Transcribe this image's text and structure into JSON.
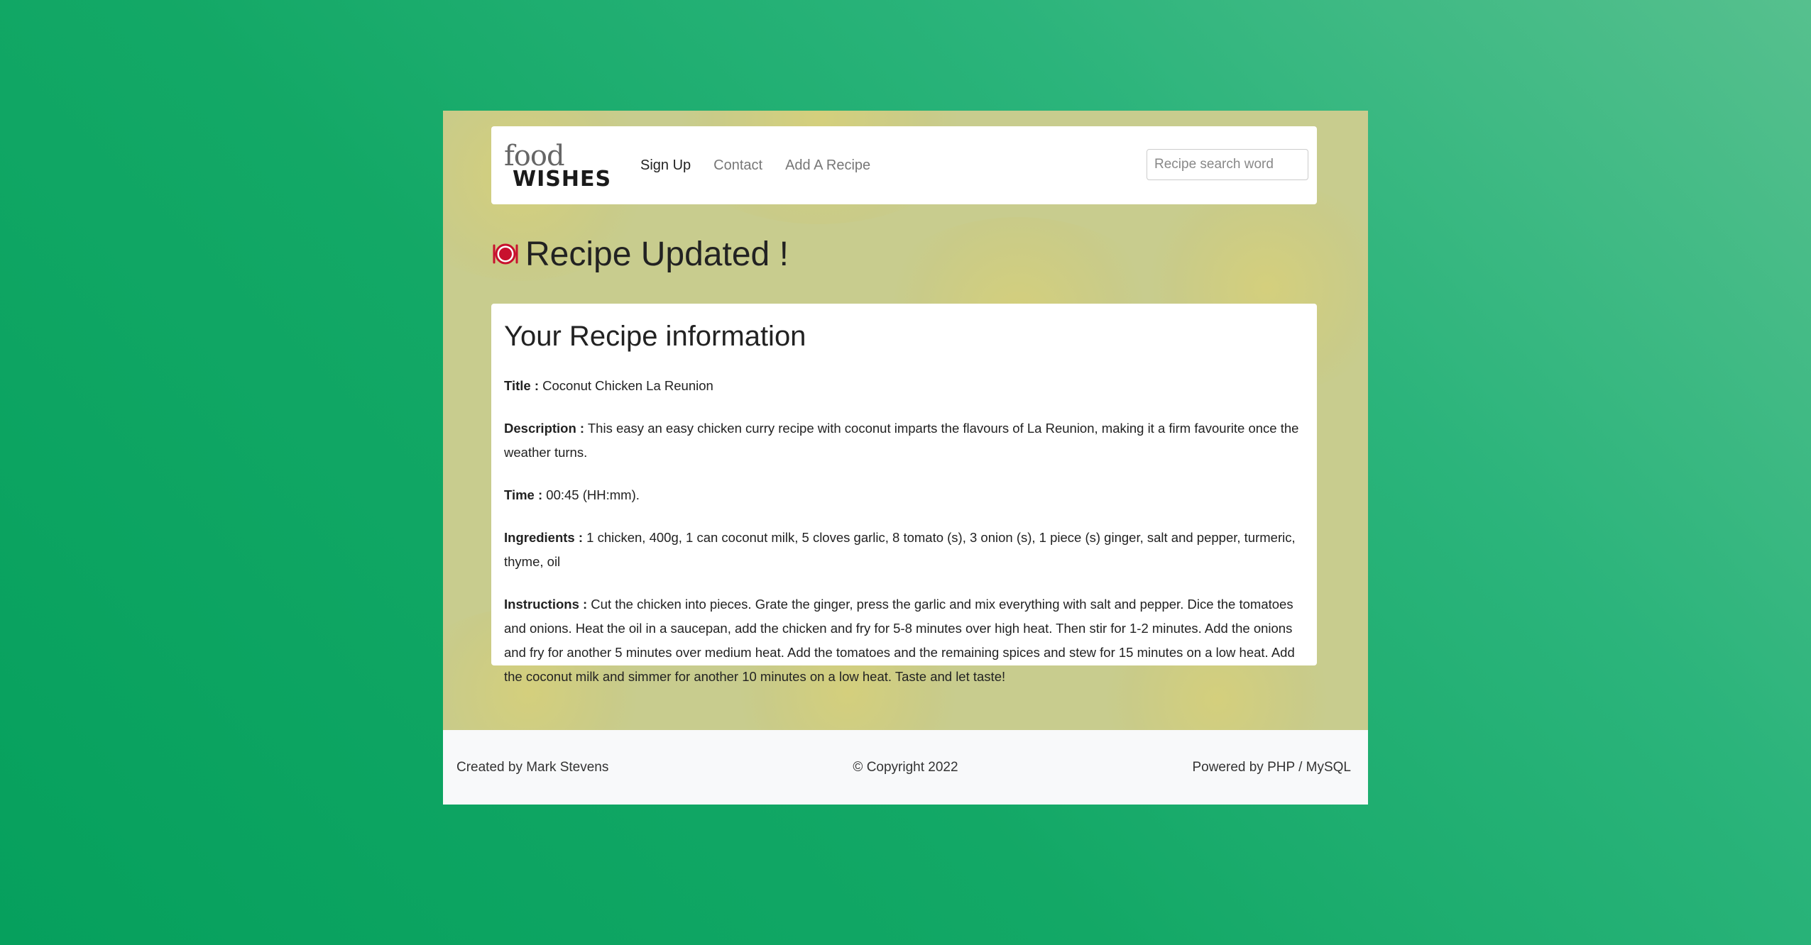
{
  "logo": {
    "line1": "food",
    "line2": "WISHES"
  },
  "nav": {
    "items": [
      {
        "label": "Sign Up"
      },
      {
        "label": "Contact"
      },
      {
        "label": "Add A Recipe"
      }
    ]
  },
  "search": {
    "placeholder": "Recipe search word",
    "value": ""
  },
  "page": {
    "title": "Recipe Updated !",
    "icon": "plate-cutlery-icon"
  },
  "card": {
    "title": "Your Recipe information",
    "fields": [
      {
        "label": "Title :",
        "value": " Coconut Chicken La Reunion"
      },
      {
        "label": "Description :",
        "value": " This easy an easy chicken curry recipe with coconut imparts the flavours of La Reunion, making it a firm favourite once the weather turns."
      },
      {
        "label": "Time :",
        "value": " 00:45 (HH:mm)."
      },
      {
        "label": "Ingredients :",
        "value": " 1 chicken, 400g, 1 can coconut milk, 5 cloves garlic, 8 tomato (s), 3 onion (s), 1 piece (s) ginger, salt and pepper, turmeric, thyme, oil"
      },
      {
        "label": "Instructions :",
        "value": " Cut the chicken into pieces. Grate the ginger, press the garlic and mix everything with salt and pepper. Dice the tomatoes and onions. Heat the oil in a saucepan, add the chicken and fry for 5-8 minutes over high heat. Then stir for 1-2 minutes. Add the onions and fry for another 5 minutes over medium heat. Add the tomatoes and the remaining spices and stew for 15 minutes on a low heat. Add the coconut milk and simmer for another 10 minutes on a low heat. Taste and let taste!"
      }
    ]
  },
  "footer": {
    "left": "Created by Mark Stevens",
    "center": "© Copyright 2022",
    "right": "Powered by PHP / MySQL"
  },
  "colors": {
    "background_accent": "#06a05d",
    "page_bg": "#c8cc8e",
    "icon_red": "#c8102e"
  }
}
